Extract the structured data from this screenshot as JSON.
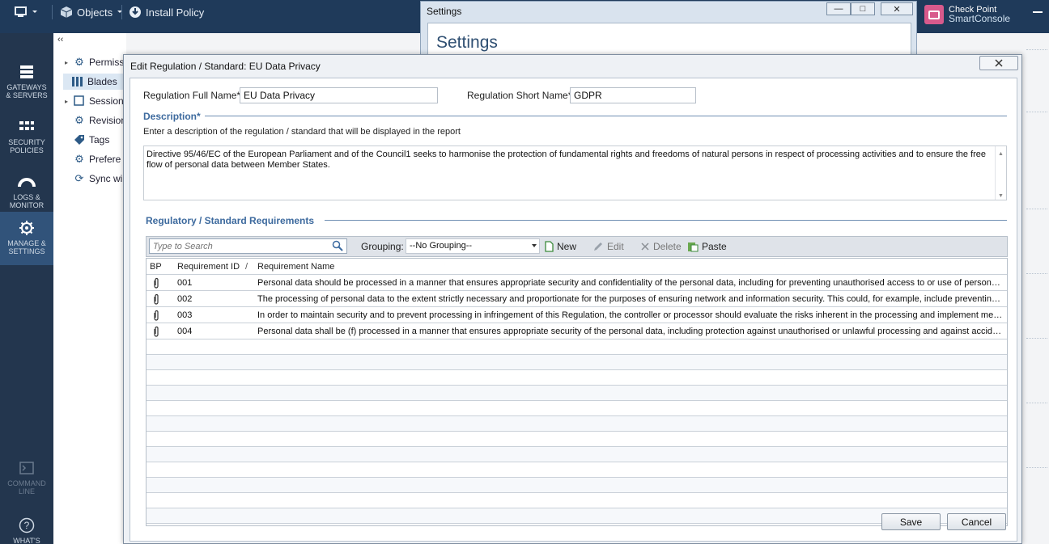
{
  "topbar": {
    "objects_label": "Objects",
    "install_policy_label": "Install Policy",
    "brand_line1": "Check Point",
    "brand_line2": "SmartConsole"
  },
  "leftnav": {
    "items": [
      {
        "label1": "GATEWAYS",
        "label2": "& SERVERS"
      },
      {
        "label1": "SECURITY",
        "label2": "POLICIES"
      },
      {
        "label1": "LOGS &",
        "label2": "MONITOR"
      },
      {
        "label1": "MANAGE &",
        "label2": "SETTINGS"
      },
      {
        "label1": "COMMAND",
        "label2": "LINE"
      },
      {
        "label1": "WHAT'S",
        "label2": ""
      }
    ]
  },
  "tree": {
    "collapse": "‹‹",
    "items": [
      {
        "label": "Permiss"
      },
      {
        "label": "Blades"
      },
      {
        "label": "Sessions"
      },
      {
        "label": "Revision"
      },
      {
        "label": "Tags"
      },
      {
        "label": "Prefere"
      },
      {
        "label": "Sync wi"
      }
    ]
  },
  "settings_window": {
    "title": "Settings",
    "heading": "Settings"
  },
  "dialog": {
    "title": "Edit Regulation / Standard: EU Data Privacy",
    "full_name_label": "Regulation Full Name*:",
    "full_name_value": "EU Data Privacy",
    "short_name_label": "Regulation Short Name*:",
    "short_name_value": "GDPR",
    "description_title": "Description*",
    "description_hint": "Enter a description of the regulation / standard that will be displayed in the report",
    "description_text": "Directive 95/46/EC of the European Parliament and of the Council1 seeks to harmonise the protection of fundamental rights and freedoms of natural persons in respect of processing activities and to ensure the free flow of personal data between Member States.",
    "requirements_title": "Regulatory / Standard Requirements",
    "toolbar": {
      "search_placeholder": "Type to Search",
      "grouping_label": "Grouping:",
      "grouping_value": "--No Grouping--",
      "new_label": "New",
      "edit_label": "Edit",
      "delete_label": "Delete",
      "paste_label": "Paste"
    },
    "grid": {
      "columns": {
        "bp": "BP",
        "id": "Requirement ID",
        "sort": "/",
        "name": "Requirement Name"
      },
      "rows": [
        {
          "id": "001",
          "name": "Personal data should be processed in a manner that ensures appropriate security and confidentiality of the personal data, including for preventing unauthorised access to or use of personal data and the equipment used for the processing."
        },
        {
          "id": "002",
          "name": "The processing of personal data to the extent strictly necessary and proportionate for the purposes of ensuring network and information security. This could, for example, include preventing unauthorised access to electronic communications networks."
        },
        {
          "id": "003",
          "name": "In order to maintain security and to prevent processing in infringement of this Regulation, the controller or processor should evaluate the risks inherent in the processing and implement measures to mitigate those risks."
        },
        {
          "id": "004",
          "name": "Personal data shall be (f) processed in a manner that ensures appropriate security of the personal data, including protection against unauthorised or unlawful processing and against accidental loss, destruction or damage."
        }
      ]
    },
    "save_label": "Save",
    "cancel_label": "Cancel"
  }
}
